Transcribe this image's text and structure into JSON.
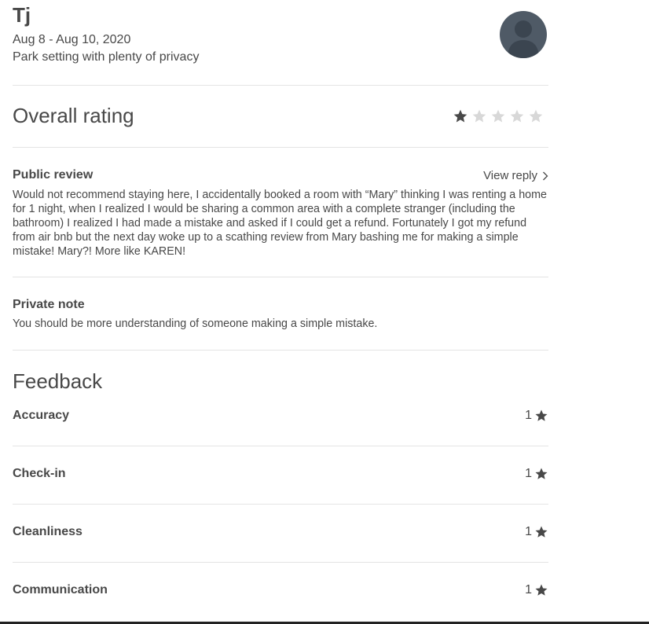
{
  "reviewer": {
    "name": "Tj",
    "dates": "Aug 8 - Aug 10, 2020",
    "listing": "Park setting with plenty of privacy",
    "avatar_icon": "user-silhouette-icon"
  },
  "overall": {
    "title": "Overall rating",
    "rating": 1,
    "max": 5,
    "filled_color": "#484848",
    "empty_color": "#d8d8d8"
  },
  "public_review": {
    "title": "Public review",
    "view_reply": "View reply",
    "text": "Would not recommend staying here, I accidentally booked a room with “Mary” thinking I was renting a home for 1 night, when I realized I would be sharing a common area with a complete stranger (including the bathroom) I realized I had made a mistake and asked if I could get a refund. Fortunately I got my refund from air bnb but the next day woke up to a scathing review from Mary bashing me for making a simple mistake! Mary?! More like KAREN!"
  },
  "private_note": {
    "title": "Private note",
    "text": "You should be more understanding of someone making a simple mistake."
  },
  "feedback": {
    "title": "Feedback",
    "items": [
      {
        "label": "Accuracy",
        "score": "1"
      },
      {
        "label": "Check-in",
        "score": "1"
      },
      {
        "label": "Cleanliness",
        "score": "1"
      },
      {
        "label": "Communication",
        "score": "1"
      }
    ]
  }
}
